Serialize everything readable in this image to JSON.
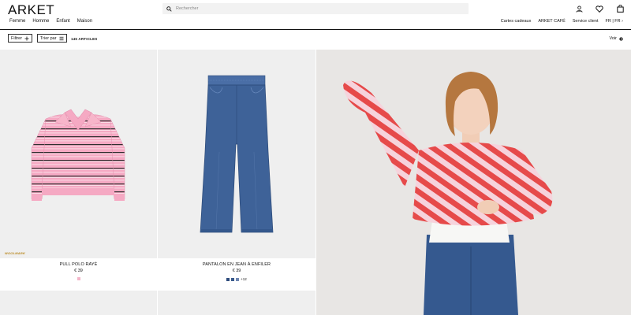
{
  "header": {
    "logo": "ARKET",
    "nav": [
      "Femme",
      "Homme",
      "Enfant",
      "Maison"
    ],
    "search_placeholder": "Rechercher",
    "right_links": [
      "Cartes cadeaux",
      "ARKET CAFÉ",
      "Service client",
      "FR | FR ›"
    ],
    "icons": [
      "account-icon",
      "heart-icon",
      "bag-icon"
    ]
  },
  "filterbar": {
    "filter_label": "Filtrer",
    "sort_label": "Trier par",
    "count_label": "145 ARTICLES",
    "view_label": "Voir"
  },
  "products": [
    {
      "name": "PULL POLO RAYÉ",
      "price": "€ 39",
      "badge": "WOOLMARK",
      "swatches": [
        "#f3b5c9"
      ],
      "more": ""
    },
    {
      "name": "PANTALON EN JEAN À ENFILER",
      "price": "€ 39",
      "badge": "",
      "swatches": [
        "#2f4c7d",
        "#3a5a8c",
        "#6e86b0"
      ],
      "more": "+12"
    }
  ],
  "colors": {
    "stripe_pink": "#f4a6c0",
    "stripe_dark": "#333333",
    "denim": "#3f6296",
    "stripe_red": "#e84e4e",
    "hero_bg": "#e8e6e4"
  }
}
